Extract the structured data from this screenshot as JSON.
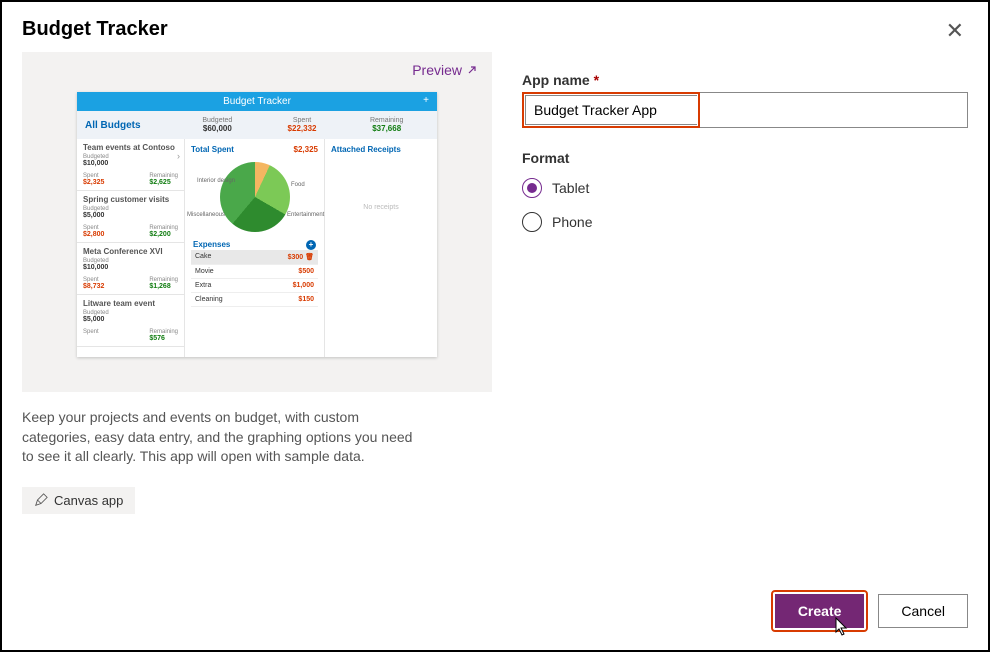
{
  "header": {
    "title": "Budget Tracker"
  },
  "preview": {
    "link_label": "Preview",
    "mock": {
      "title": "Budget Tracker",
      "all_budgets_label": "All Budgets",
      "summary": {
        "budgeted_label": "Budgeted",
        "budgeted_value": "$60,000",
        "spent_label": "Spent",
        "spent_value": "$22,332",
        "remaining_label": "Remaining",
        "remaining_value": "$37,668"
      },
      "side_items": [
        {
          "title": "Team events at Contoso",
          "budgeted_label": "Budgeted",
          "budgeted": "$10,000",
          "spent_label": "Spent",
          "spent": "$2,325",
          "remaining_label": "Remaining",
          "remaining": "$2,625",
          "selected": true
        },
        {
          "title": "Spring customer visits",
          "budgeted_label": "Budgeted",
          "budgeted": "$5,000",
          "spent_label": "Spent",
          "spent": "$2,800",
          "remaining_label": "Remaining",
          "remaining": "$2,200"
        },
        {
          "title": "Meta Conference XVI",
          "budgeted_label": "Budgeted",
          "budgeted": "$10,000",
          "spent_label": "Spent",
          "spent": "$8,732",
          "remaining_label": "Remaining",
          "remaining": "$1,268"
        },
        {
          "title": "Litware team event",
          "budgeted_label": "Budgeted",
          "budgeted": "$5,000",
          "spent_label": "Spent",
          "spent": "",
          "remaining_label": "Remaining",
          "remaining": "$576"
        }
      ],
      "total_spent_label": "Total Spent",
      "total_spent_value": "$2,325",
      "pie_labels": {
        "a": "Interior design",
        "b": "Food",
        "c": "Miscellaneous",
        "d": "Entertainment"
      },
      "expenses_label": "Expenses",
      "expenses": [
        {
          "name": "Cake",
          "amount": "$300",
          "selected": true
        },
        {
          "name": "Movie",
          "amount": "$500"
        },
        {
          "name": "Extra",
          "amount": "$1,000"
        },
        {
          "name": "Cleaning",
          "amount": "$150"
        }
      ],
      "attached_label": "Attached Receipts",
      "no_receipts": "No receipts"
    }
  },
  "description": "Keep your projects and events on budget, with custom categories, easy data entry, and the graphing options you need to see it all clearly. This app will open with sample data.",
  "app_type_badge": "Canvas app",
  "form": {
    "app_name_label": "App name",
    "required_mark": "*",
    "app_name_value": "Budget Tracker App",
    "format_label": "Format",
    "options": {
      "tablet": "Tablet",
      "phone": "Phone"
    },
    "selected": "tablet"
  },
  "footer": {
    "create": "Create",
    "cancel": "Cancel"
  }
}
